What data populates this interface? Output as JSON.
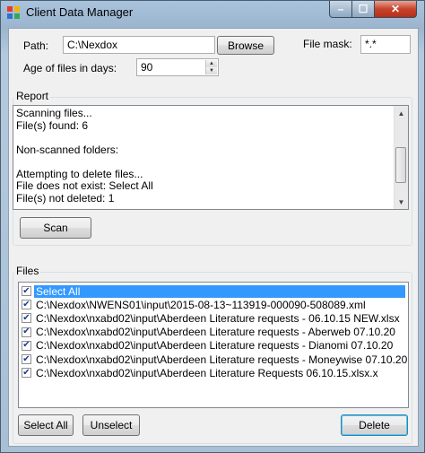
{
  "window": {
    "title": "Client Data Manager"
  },
  "titlebar": {
    "minimize": "–",
    "maximize": "☐",
    "close": "✕"
  },
  "form": {
    "path_label": "Path:",
    "path_value": "C:\\Nexdox",
    "browse_label": "Browse",
    "mask_label": "File mask:",
    "mask_value": "*.*",
    "age_label": "Age of files in days:",
    "age_value": "90"
  },
  "report": {
    "title": "Report",
    "lines": [
      "Scanning files...",
      "File(s) found: 6",
      "",
      "Non-scanned folders:",
      "",
      "Attempting to delete files...",
      "File does not exist: Select All",
      "File(s) not deleted: 1"
    ],
    "scan_label": "Scan"
  },
  "files": {
    "title": "Files",
    "items": [
      {
        "label": "Select All",
        "checked": true,
        "selected": true
      },
      {
        "label": "C:\\Nexdox\\NWENS01\\input\\2015-08-13~113919-000090-508089.xml",
        "checked": true,
        "selected": false
      },
      {
        "label": "C:\\Nexdox\\nxabd02\\input\\Aberdeen Literature requests - 06.10.15 NEW.xlsx",
        "checked": true,
        "selected": false
      },
      {
        "label": "C:\\Nexdox\\nxabd02\\input\\Aberdeen Literature requests - Aberweb 07.10.20",
        "checked": true,
        "selected": false
      },
      {
        "label": "C:\\Nexdox\\nxabd02\\input\\Aberdeen Literature requests - Dianomi 07.10.20",
        "checked": true,
        "selected": false
      },
      {
        "label": "C:\\Nexdox\\nxabd02\\input\\Aberdeen Literature requests - Moneywise 07.10.20",
        "checked": true,
        "selected": false
      },
      {
        "label": "C:\\Nexdox\\nxabd02\\input\\Aberdeen Literature Requests 06.10.15.xlsx.x",
        "checked": true,
        "selected": false
      }
    ]
  },
  "buttons": {
    "select_all": "Select All",
    "unselect": "Unselect",
    "delete": "Delete"
  },
  "colors": {
    "selection": "#3399ff",
    "client_bg": "#f0f0f0"
  }
}
